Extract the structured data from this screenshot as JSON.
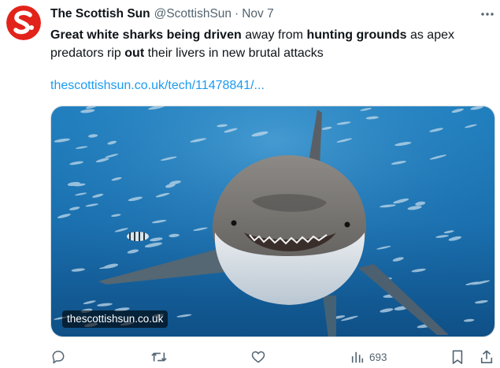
{
  "tweet": {
    "author_name": "The Scottish Sun",
    "handle": "@ScottishSun",
    "separator": "·",
    "date": "Nov 7",
    "text_parts": [
      {
        "t": "Great white sharks being driven",
        "b": true
      },
      {
        "t": " away from ",
        "b": false
      },
      {
        "t": "hunting grounds",
        "b": true
      },
      {
        "t": " as apex predators rip ",
        "b": false
      },
      {
        "t": "out",
        "b": true
      },
      {
        "t": " their livers in new brutal attacks",
        "b": false
      }
    ],
    "link": "thescottishsun.co.uk/tech/11478841/...",
    "media_domain": "thescottishsun.co.uk",
    "views": "693"
  },
  "icons": {
    "avatar": "scottish-sun-logo",
    "more": "more-dots-icon",
    "reply": "reply-icon",
    "retweet": "retweet-icon",
    "like": "like-icon",
    "views": "views-icon",
    "bookmark": "bookmark-icon",
    "share": "share-icon"
  },
  "colors": {
    "brand_red": "#e2231a",
    "link_blue": "#1d9bf0",
    "muted": "#536471",
    "text": "#0f1419"
  }
}
